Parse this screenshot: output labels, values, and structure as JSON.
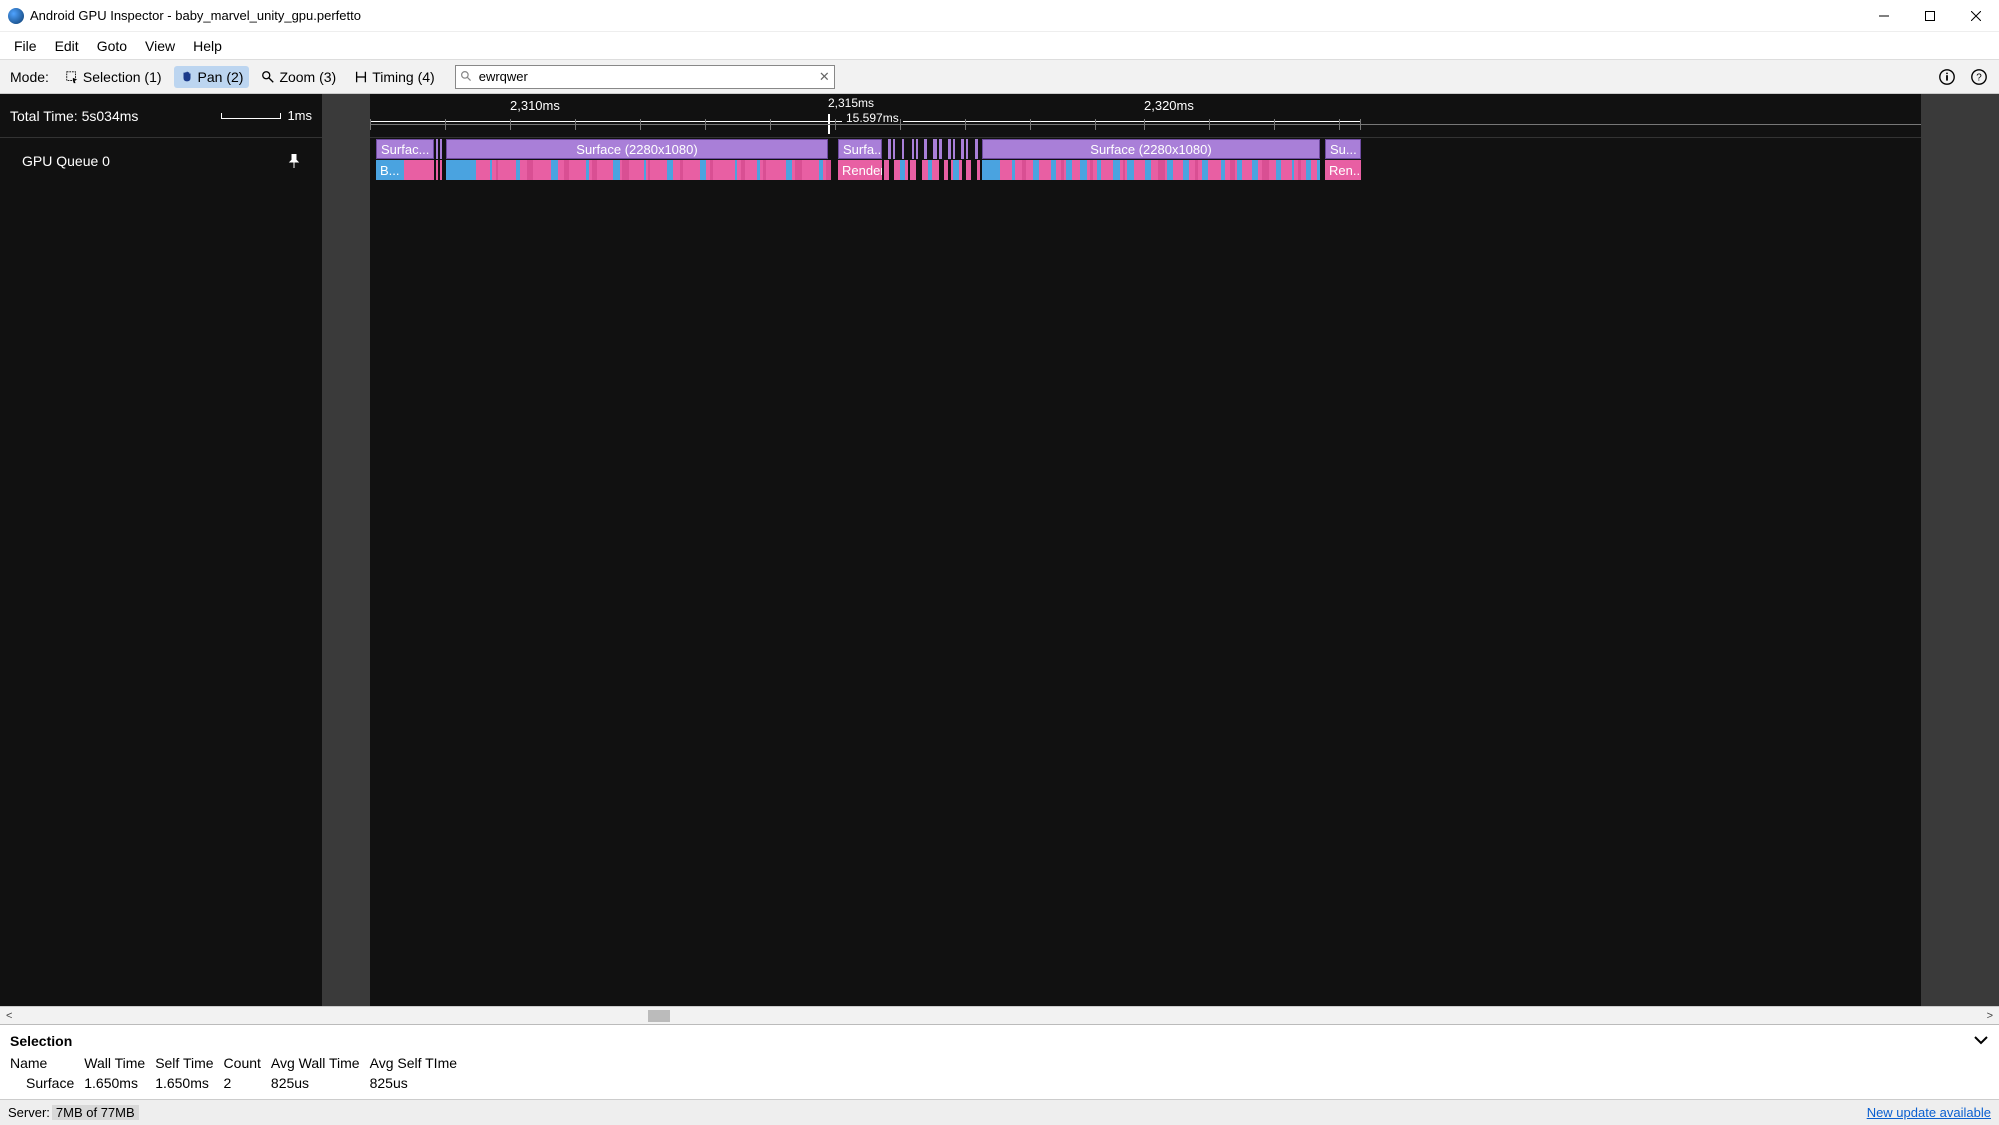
{
  "title": "Android GPU Inspector - baby_marvel_unity_gpu.perfetto",
  "menu": {
    "file": "File",
    "edit": "Edit",
    "goto": "Goto",
    "view": "View",
    "help": "Help"
  },
  "toolbar": {
    "mode_label": "Mode:",
    "selection": "Selection (1)",
    "pan": "Pan (2)",
    "zoom": "Zoom (3)",
    "timing": "Timing (4)",
    "search_value": "ewrqwer"
  },
  "timeline": {
    "total_time_label": "Total Time: 5s034ms",
    "scale_label": "1ms",
    "tick1": "2,310ms",
    "tick2": "2,320ms",
    "marker_label": "2,315ms",
    "marker_span": "15.597ms",
    "track_name": "GPU Queue 0",
    "surface_full": "Surface (2280x1080)",
    "surfac_short": "Surfac...",
    "surfa_short": "Surfa...",
    "su_short": "Su...",
    "b_short": "B...",
    "render": "Render",
    "ren_short": "Ren..."
  },
  "selection": {
    "heading": "Selection",
    "columns": {
      "name": "Name",
      "wall": "Wall Time",
      "self": "Self Time",
      "count": "Count",
      "avgwall": "Avg Wall Time",
      "avgself": "Avg Self TIme"
    },
    "row": {
      "name": "Surface",
      "wall": "1.650ms",
      "self": "1.650ms",
      "count": "2",
      "avgwall": "825us",
      "avgself": "825us"
    }
  },
  "status": {
    "server_label": "Server:",
    "mem": "7MB of 77MB",
    "update": "New update available"
  }
}
